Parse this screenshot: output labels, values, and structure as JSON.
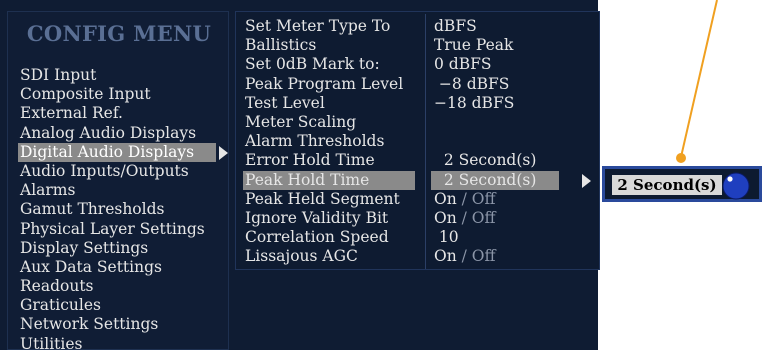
{
  "menu": {
    "title": "CONFIG MENU",
    "items": [
      {
        "label": "SDI Input"
      },
      {
        "label": "Composite Input"
      },
      {
        "label": "External Ref."
      },
      {
        "label": "Analog Audio Displays"
      },
      {
        "label": "Digital Audio Displays",
        "selected": true
      },
      {
        "label": "Audio Inputs/Outputs"
      },
      {
        "label": "Alarms"
      },
      {
        "label": "Gamut Thresholds"
      },
      {
        "label": "Physical Layer Settings"
      },
      {
        "label": "Display Settings"
      },
      {
        "label": "Aux Data Settings"
      },
      {
        "label": "Readouts"
      },
      {
        "label": "Graticules"
      },
      {
        "label": "Network Settings"
      },
      {
        "label": "Utilities"
      }
    ]
  },
  "params": [
    {
      "name": "Set Meter Type To",
      "value": "dBFS"
    },
    {
      "name": "Ballistics",
      "value": "True Peak"
    },
    {
      "name": "Set 0dB Mark to:",
      "value": "0 dBFS"
    },
    {
      "name": "Peak Program Level",
      "value": " −8 dBFS"
    },
    {
      "name": "Test Level",
      "value": "−18 dBFS"
    },
    {
      "name": "Meter Scaling",
      "value": ""
    },
    {
      "name": "Alarm Thresholds",
      "value": ""
    },
    {
      "name": "Error Hold Time",
      "value": "  2 Second(s)"
    },
    {
      "name": "Peak Hold Time",
      "value": "  2 Second(s)",
      "selected": true
    },
    {
      "name": "Peak Held Segment",
      "on": "On",
      "off": "Off"
    },
    {
      "name": "Ignore Validity Bit",
      "on": "On",
      "off": "Off"
    },
    {
      "name": "Correlation Speed",
      "value": " 10"
    },
    {
      "name": "Lissajous AGC",
      "on": "On",
      "off": "Off"
    }
  ],
  "popup": {
    "value": "2 Second(s)",
    "knob_icon": "rotary-knob-icon"
  },
  "colors": {
    "background": "#0f1c33",
    "selection": "#8a8a8a",
    "popup_border": "#2a4a9c",
    "knob": "#1f3fbf",
    "leader_line": "#f0a020"
  }
}
